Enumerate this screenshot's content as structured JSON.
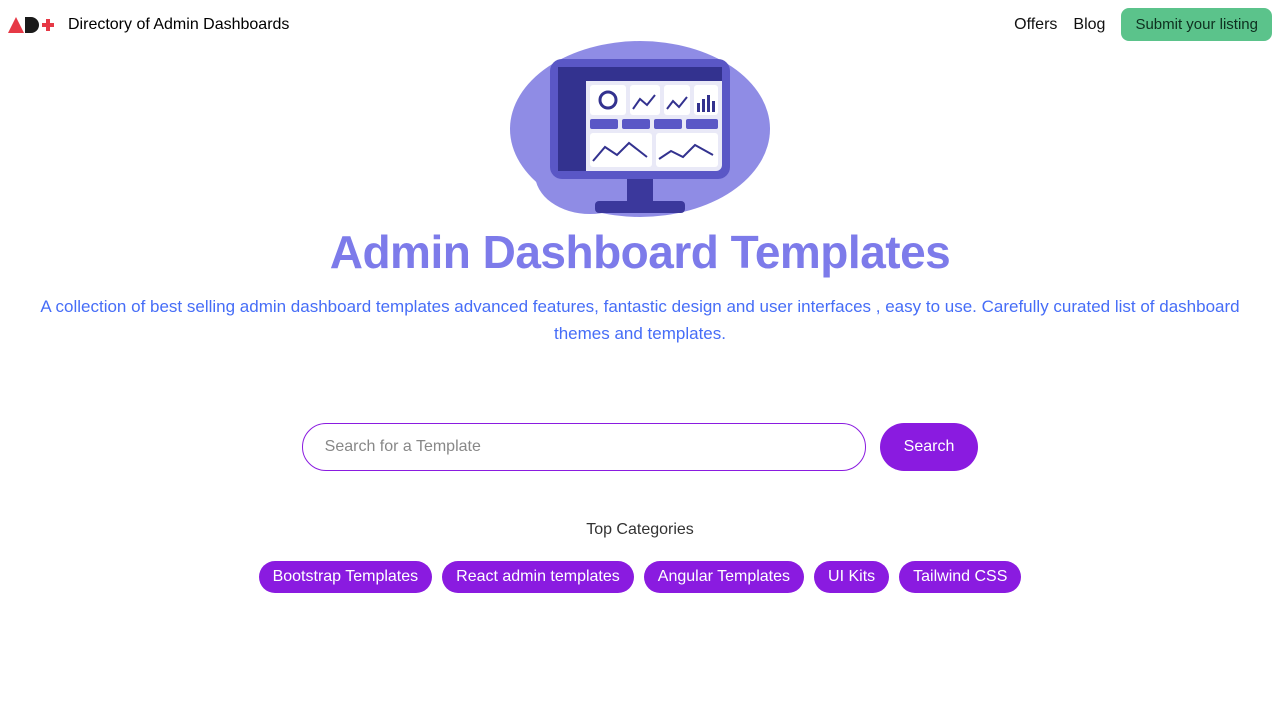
{
  "header": {
    "brand": "Directory of Admin Dashboards",
    "nav": {
      "offers": "Offers",
      "blog": "Blog",
      "submit": "Submit your listing"
    }
  },
  "hero": {
    "title": "Admin Dashboard Templates",
    "subtitle": "A collection of best selling admin dashboard templates advanced features, fantastic design and user interfaces , easy to use. Carefully curated list of dashboard themes and templates."
  },
  "search": {
    "placeholder": "Search for a Template",
    "button": "Search"
  },
  "categories": {
    "heading": "Top Categories",
    "items": [
      "Bootstrap Templates",
      "React admin templates",
      "Angular Templates",
      "UI Kits",
      "Tailwind CSS"
    ]
  },
  "colors": {
    "accent_purple": "#8a1be0",
    "brand_indigo": "#7d7bea",
    "link_blue": "#466df7",
    "cta_green": "#5bc38b",
    "logo_red": "#e63946"
  }
}
